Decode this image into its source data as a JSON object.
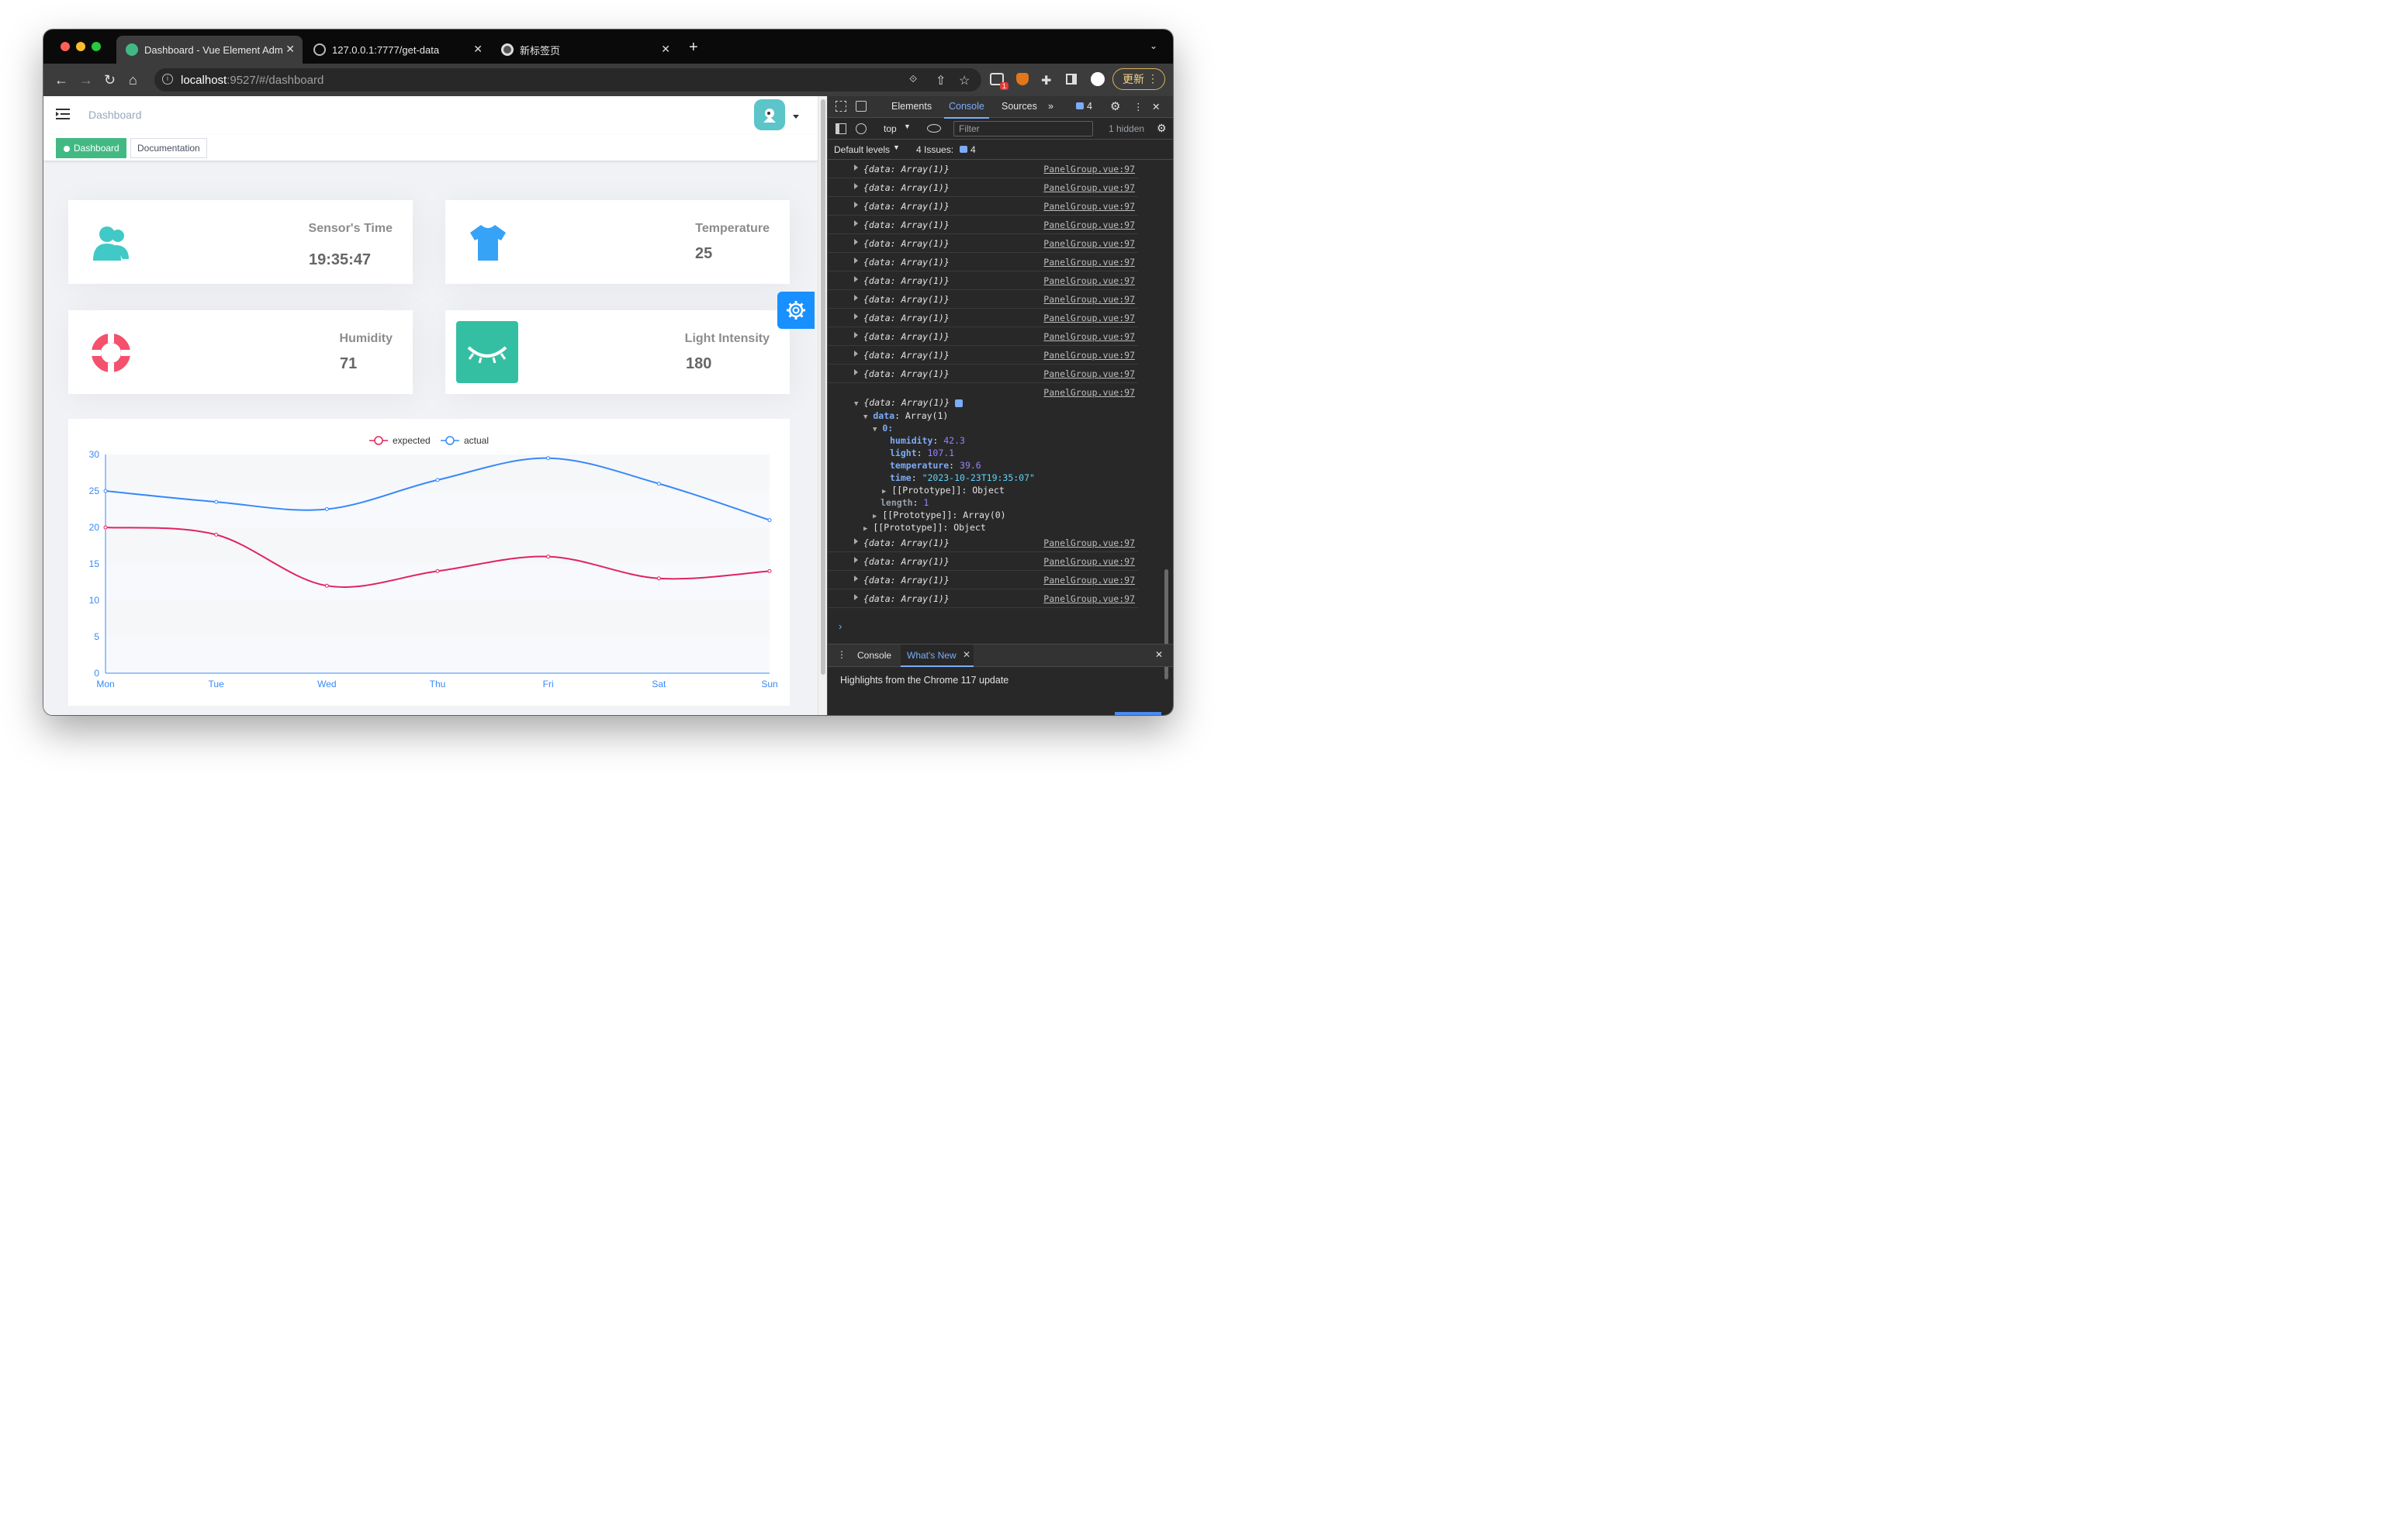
{
  "browser": {
    "tabs": [
      {
        "title": "Dashboard - Vue Element Adm",
        "active": true
      },
      {
        "title": "127.0.0.1:7777/get-data",
        "active": false
      },
      {
        "title": "新标签页",
        "active": false
      }
    ],
    "url_host": "localhost",
    "url_rest": ":9527/#/dashboard",
    "update_label": "更新",
    "extension_badge": "1"
  },
  "app": {
    "breadcrumb": "Dashboard",
    "tags": [
      {
        "label": "Dashboard",
        "active": true
      },
      {
        "label": "Documentation",
        "active": false
      }
    ],
    "panels": [
      {
        "label": "Sensor's Time",
        "value": "19:35:47",
        "icon": "peoples-icon",
        "color": "#40c9c6"
      },
      {
        "label": "Temperature",
        "value": "25",
        "icon": "shirt-icon",
        "color": "#36a3f7"
      },
      {
        "label": "Humidity",
        "value": "71",
        "icon": "lifebuoy-icon",
        "color": "#f4516c"
      },
      {
        "label": "Light Intensity",
        "value": "180",
        "icon": "eye-closed-icon",
        "color": "#34bfa3"
      }
    ]
  },
  "chart_data": {
    "type": "line",
    "categories": [
      "Mon",
      "Tue",
      "Wed",
      "Thu",
      "Fri",
      "Sat",
      "Sun"
    ],
    "series": [
      {
        "name": "expected",
        "values": [
          20,
          19,
          12,
          14,
          16,
          13,
          14
        ],
        "color": "#e0245e"
      },
      {
        "name": "actual",
        "values": [
          25,
          23.5,
          22.5,
          26.5,
          29.5,
          26,
          21
        ],
        "color": "#3888fa"
      }
    ],
    "ylim": [
      0,
      30
    ],
    "yticks": [
      "0",
      "5",
      "10",
      "15",
      "20",
      "25",
      "30"
    ],
    "legend": "top-center",
    "smooth": true
  },
  "devtools": {
    "tabs": [
      "Elements",
      "Console",
      "Sources"
    ],
    "selected_tab": "Console",
    "issues_badge": "4",
    "context": "top",
    "filter_placeholder": "Filter",
    "hidden_count": "1 hidden",
    "levels": "Default levels",
    "issues_label": "4 Issues:",
    "issues_count": "4",
    "log_text": "{data: Array(1)}",
    "log_source": "PanelGroup.vue:97",
    "expanded": {
      "header": "{data: Array(1)}",
      "data_label": "data",
      "data_type": "Array(1)",
      "index": "0:",
      "humidity_key": "humidity",
      "humidity": "42.3",
      "light_key": "light",
      "light": "107.1",
      "temperature_key": "temperature",
      "temperature": "39.6",
      "time_key": "time",
      "time": "\"2023-10-23T19:35:07\"",
      "proto_object": "[[Prototype]]: Object",
      "length_key": "length",
      "length": "1",
      "proto_array": "[[Prototype]]: Array(0)",
      "proto_object2": "[[Prototype]]: Object"
    },
    "drawer_tabs": [
      "Console",
      "What's New"
    ],
    "whats_new_text": "Highlights from the Chrome 117 update"
  }
}
